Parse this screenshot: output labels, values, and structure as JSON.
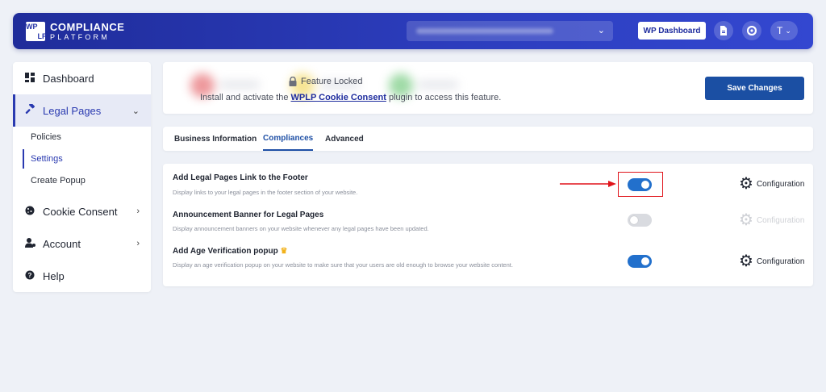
{
  "header": {
    "logo_mark": [
      "WP",
      "LP"
    ],
    "logo_line1": "COMPLIANCE",
    "logo_line2": "PLATFORM",
    "site_select_icon": "chevron-down-icon",
    "wp_dashboard_label": "WP Dashboard",
    "icons": [
      "document-icon",
      "help-lifebuoy-icon"
    ],
    "user_initial": "T"
  },
  "sidebar": {
    "items": [
      {
        "label": "Dashboard",
        "icon": "dashboard-icon"
      },
      {
        "label": "Legal Pages",
        "icon": "gavel-icon"
      },
      {
        "label": "Cookie Consent",
        "icon": "cookie-icon"
      },
      {
        "label": "Account",
        "icon": "user-gear-icon"
      },
      {
        "label": "Help",
        "icon": "question-circle-icon"
      }
    ],
    "sub_items": [
      "Policies",
      "Settings",
      "Create Popup"
    ]
  },
  "locked": {
    "title": "Feature Locked",
    "msg_before": "Install and activate the ",
    "link": "WPLP Cookie Consent",
    "msg_after": " plugin to access this feature.",
    "save_label": "Save Changes"
  },
  "tabs": [
    "Business Information",
    "Compliances",
    "Advanced"
  ],
  "settings": [
    {
      "title": "Add Legal Pages Link to the Footer",
      "desc": "Display links to your legal pages in the footer section of your website.",
      "enabled": true,
      "config_label": "Configuration"
    },
    {
      "title": "Announcement Banner for Legal Pages",
      "desc": "Display announcement banners on your website whenever any legal pages have been updated.",
      "enabled": false,
      "config_label": "Configuration"
    },
    {
      "title": "Add Age Verification popup",
      "badge": "crown-icon",
      "desc": "Display an age verification popup on your website to make sure that your users are old enough to browse your website content.",
      "enabled": true,
      "config_label": "Configuration"
    }
  ],
  "colors": {
    "header_start": "#1f2c9a",
    "header_end": "#3347d0",
    "accent": "#1e4fa5",
    "toggle_on": "#2270cc",
    "annotation": "#e0141b"
  }
}
